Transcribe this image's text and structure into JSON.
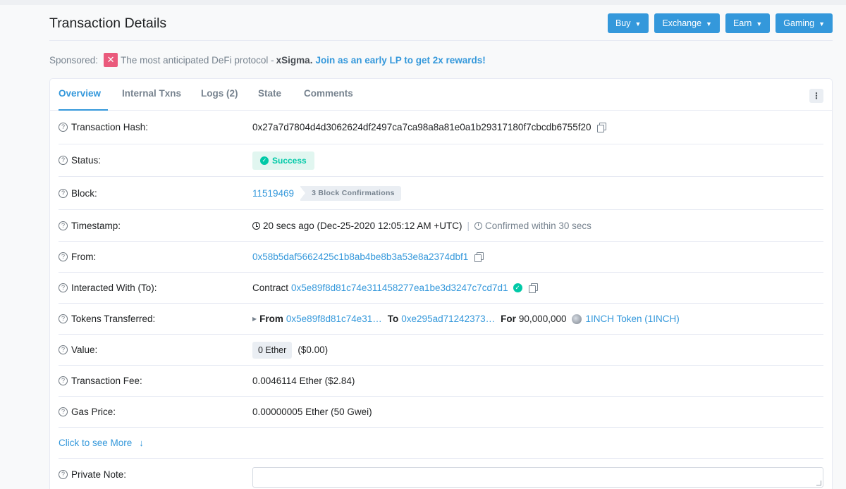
{
  "header": {
    "title": "Transaction Details",
    "buttons": [
      {
        "label": "Buy"
      },
      {
        "label": "Exchange"
      },
      {
        "label": "Earn"
      },
      {
        "label": "Gaming"
      }
    ]
  },
  "sponsored": {
    "prefix": "Sponsored:",
    "text": "The most anticipated DeFi protocol -",
    "brand": "xSigma.",
    "link": "Join as an early LP to get 2x rewards!"
  },
  "tabs": [
    {
      "label": "Overview",
      "active": true
    },
    {
      "label": "Internal Txns"
    },
    {
      "label": "Logs (2)"
    },
    {
      "label": "State"
    },
    {
      "label": "Comments"
    }
  ],
  "menu_icon": "⋮",
  "rows": {
    "hash": {
      "label": "Transaction Hash:",
      "value": "0x27a7d7804d4d3062624df2497ca7ca98a8a81e0a1b29317180f7cbcdb6755f20"
    },
    "status": {
      "label": "Status:",
      "value": "Success"
    },
    "block": {
      "label": "Block:",
      "value": "11519469",
      "confirmations": "3 Block Confirmations"
    },
    "timestamp": {
      "label": "Timestamp:",
      "value": "20 secs ago (Dec-25-2020 12:05:12 AM +UTC)",
      "separator": "|",
      "confirmed": "Confirmed within 30 secs"
    },
    "from": {
      "label": "From:",
      "value": "0x58b5daf5662425c1b8ab4be8b3a53e8a2374dbf1"
    },
    "to": {
      "label": "Interacted With (To):",
      "prefix": "Contract",
      "value": "0x5e89f8d81c74e311458277ea1be3d3247c7cd7d1"
    },
    "tokens": {
      "label": "Tokens Transferred:",
      "from_label": "From",
      "from": "0x5e89f8d81c74e31…",
      "to_label": "To",
      "to": "0xe295ad71242373…",
      "for_label": "For",
      "amount": "90,000,000",
      "token": "1INCH Token (1INCH)"
    },
    "value": {
      "label": "Value:",
      "ether": "0 Ether",
      "usd": "($0.00)"
    },
    "fee": {
      "label": "Transaction Fee:",
      "value": "0.0046114 Ether ($2.84)"
    },
    "gas": {
      "label": "Gas Price:",
      "value": "0.00000005 Ether (50 Gwei)"
    },
    "more": {
      "label": "Click to see More"
    },
    "note": {
      "label": "Private Note:"
    }
  },
  "colors": {
    "accent": "#3498db",
    "success": "#00c9a7",
    "sponsor_logo": "#ea5a7c"
  }
}
